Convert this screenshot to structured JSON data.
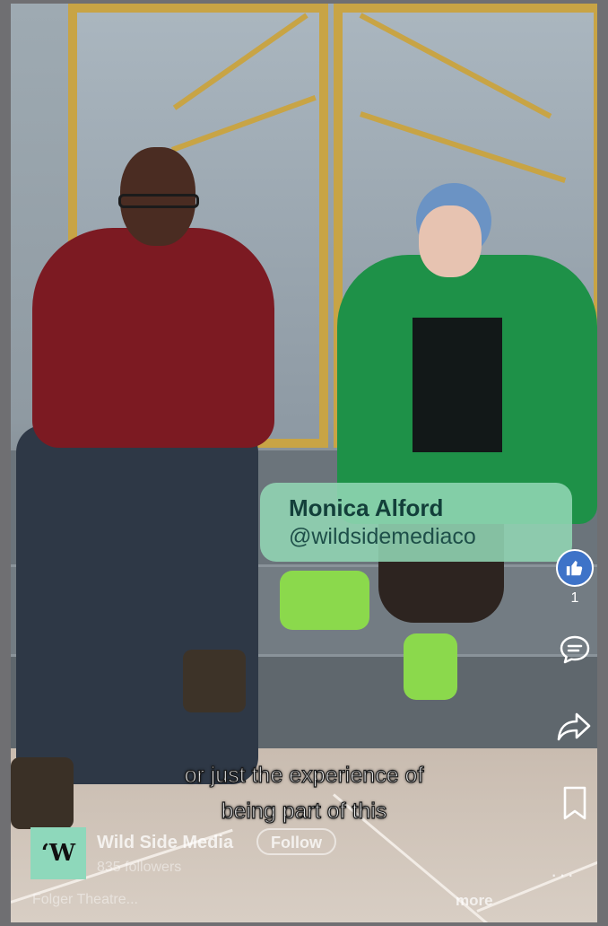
{
  "name_card": {
    "name": "Monica Alford",
    "handle": "@wildsidemediaco"
  },
  "actions": {
    "like_icon": "thumbs-up-icon",
    "like_count": "1",
    "comment_icon": "comment-icon",
    "share_icon": "share-arrow-icon",
    "save_icon": "bookmark-icon",
    "more_icon": "more-dots-icon"
  },
  "caption": {
    "line1": "or just the experience of",
    "line2": "being part of this"
  },
  "channel": {
    "logo_text": "‘W",
    "name": "Wild Side Media",
    "follow_label": "Follow",
    "followers": "835 followers",
    "description": "Folger Theatre...",
    "more_label": "more"
  },
  "colors": {
    "name_card_bg": "#92d6b4",
    "like_bg": "#3e73c8",
    "logo_bg": "#8ed8bb"
  }
}
